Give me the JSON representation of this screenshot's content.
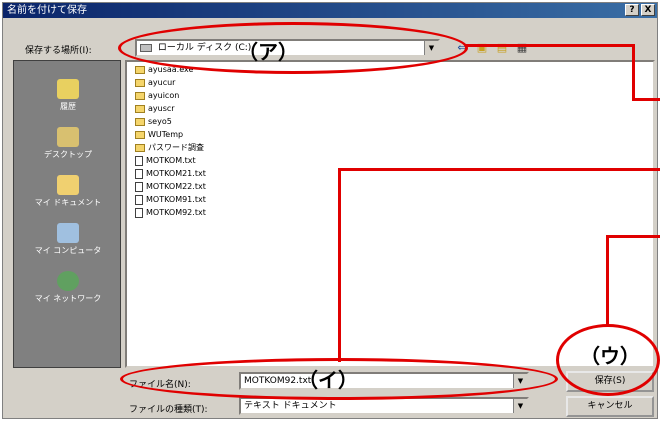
{
  "dialog": {
    "title": "名前を付けて保存",
    "help_glyph": "?",
    "close_glyph": "X"
  },
  "save_in": {
    "label": "保存する場所(I):",
    "value": "ローカル ディスク (C:)"
  },
  "places": [
    {
      "label": "履歴",
      "icon": "history-icon"
    },
    {
      "label": "デスクトップ",
      "icon": "desktop-icon"
    },
    {
      "label": "マイ ドキュメント",
      "icon": "my-documents-icon"
    },
    {
      "label": "マイ コンピュータ",
      "icon": "my-computer-icon"
    },
    {
      "label": "マイ ネットワーク",
      "icon": "my-network-icon"
    }
  ],
  "files": [
    {
      "name": "ayusaa.exe",
      "type": "folder"
    },
    {
      "name": "ayucur",
      "type": "folder"
    },
    {
      "name": "ayuicon",
      "type": "folder"
    },
    {
      "name": "ayuscr",
      "type": "folder"
    },
    {
      "name": "seyo5",
      "type": "folder"
    },
    {
      "name": "WUTemp",
      "type": "folder"
    },
    {
      "name": "パスワード調査",
      "type": "folder"
    },
    {
      "name": "MOTKOM.txt",
      "type": "doc"
    },
    {
      "name": "MOTKOM21.txt",
      "type": "doc"
    },
    {
      "name": "MOTKOM22.txt",
      "type": "doc"
    },
    {
      "name": "MOTKOM91.txt",
      "type": "doc"
    },
    {
      "name": "MOTKOM92.txt",
      "type": "doc"
    }
  ],
  "filename": {
    "label": "ファイル名(N):",
    "value": "MOTKOM92.txt"
  },
  "filetype": {
    "label": "ファイルの種類(T):",
    "value": "テキスト ドキュメント"
  },
  "buttons": {
    "save": "保存(S)",
    "cancel": "キャンセル"
  },
  "annotations": {
    "a": "（ア）",
    "i": "（イ）",
    "u": "（ウ）"
  },
  "colors": {
    "annotation": "#e00000",
    "titlebar": "#0a246a"
  }
}
